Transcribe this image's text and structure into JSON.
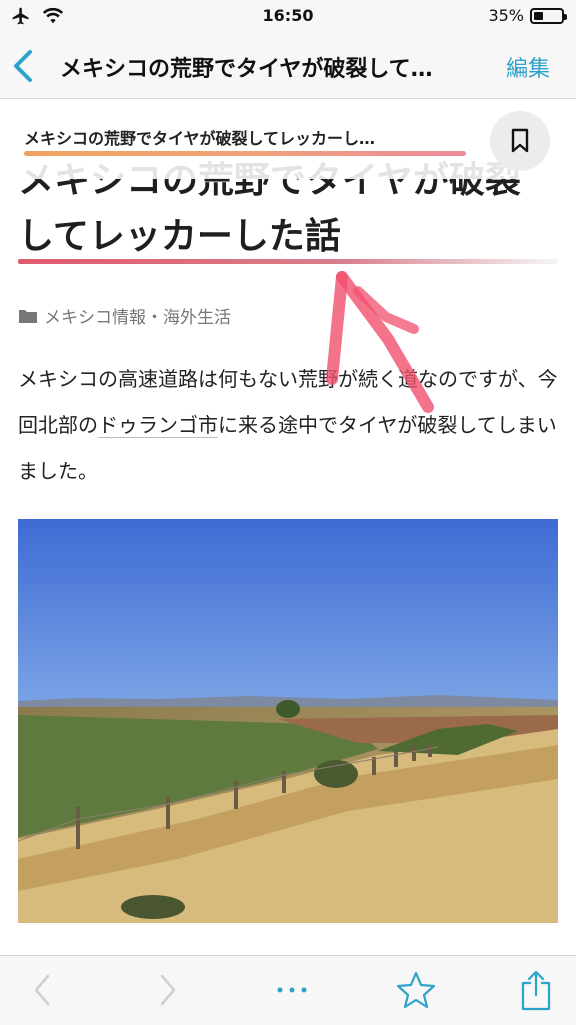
{
  "status_bar": {
    "time": "16:50",
    "battery_text": "35%",
    "battery_level": 0.35
  },
  "nav": {
    "title": "メキシコの荒野でタイヤが破裂して…",
    "edit_label": "編集",
    "back_icon": "chevron-left-icon"
  },
  "sticky_header": {
    "title": "メキシコの荒野でタイヤが破裂してレッカーし…",
    "bookmark_icon": "bookmark-icon"
  },
  "article": {
    "title_line1": "メキシコの荒野でタイヤが破裂",
    "title_line2": "してレッカーした話",
    "category": "メキシコ情報・海外生活",
    "body_before_link": "メキシコの高速道路は何もない荒野が続く道なのですが、今回北部の",
    "body_link": "ドゥランゴ市",
    "body_after_link": "に来る途中でタイヤが破裂してしまいました。"
  },
  "toolbar": {
    "icons": [
      "back-arrow-icon",
      "forward-arrow-icon",
      "more-icon",
      "star-icon",
      "share-icon"
    ]
  },
  "colors": {
    "accent": "#2ea3c9",
    "title_underline": "#e05a6d",
    "progress_start": "#f2a25d",
    "progress_end": "#ec8a9a",
    "annotation": "#f0506e"
  }
}
